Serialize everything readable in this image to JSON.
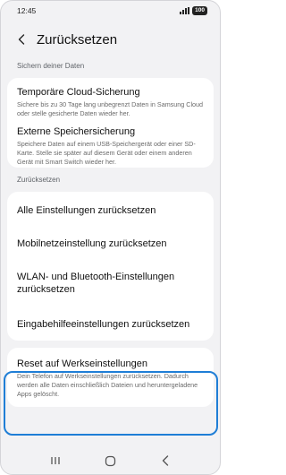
{
  "status": {
    "time": "12:45",
    "battery": "100"
  },
  "header": {
    "title": "Zurücksetzen"
  },
  "sections": {
    "backup_label": "Sichern deiner Daten",
    "reset_label": "Zurücksetzen"
  },
  "backup_items": [
    {
      "title": "Temporäre Cloud-Sicherung",
      "sub": "Sichere bis zu 30 Tage lang unbegrenzt Daten in Samsung Cloud oder stelle gesicherte Daten wieder her."
    },
    {
      "title": "Externe Speichersicherung",
      "sub": "Speichere Daten auf einem USB-Speichergerät oder einer SD-Karte. Stelle sie später auf diesem Gerät oder einem anderen Gerät mit Smart Switch wieder her."
    }
  ],
  "reset_items": [
    {
      "title": "Alle Einstellungen zurücksetzen"
    },
    {
      "title": "Mobilnetzeinstellung zurücksetzen"
    },
    {
      "title": "WLAN- und Bluetooth-Einstellungen zurücksetzen"
    },
    {
      "title": "Eingabehilfeeinstellungen zurücksetzen"
    }
  ],
  "factory_reset": {
    "title": "Reset auf Werkseinstellungen",
    "sub": "Dein Telefon auf Werkseinstellungen zurücksetzen. Dadurch werden alle Daten einschließlich Dateien und heruntergeladene Apps gelöscht."
  },
  "colors": {
    "highlight": "#1f7ed6",
    "background": "#f2f2f4",
    "card": "#ffffff"
  },
  "icons": [
    "back-arrow-icon",
    "recent-apps-icon",
    "home-icon",
    "back-icon"
  ]
}
